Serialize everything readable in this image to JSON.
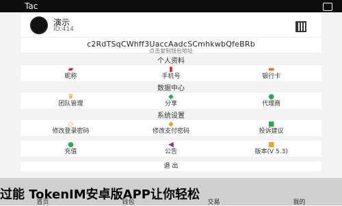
{
  "status": {
    "title": "Tac"
  },
  "profile": {
    "name": "演示",
    "uid": "ID:414"
  },
  "wallet": {
    "address": "c2RdTSqCWhff3UaccAadcSCmhkwbQfeBRb",
    "hint": "点击复制钱包地址"
  },
  "sections": [
    {
      "title": "个人资料",
      "items": [
        {
          "label": "昵称",
          "icon": "user-icon",
          "color": "#d12b2b"
        },
        {
          "label": "手机号",
          "icon": "phone-icon",
          "color": "#d12b2b"
        },
        {
          "label": "银行卡",
          "icon": "card-icon",
          "color": "#e0702a"
        }
      ]
    },
    {
      "title": "数据中心",
      "items": [
        {
          "label": "团队管理",
          "icon": "crown-icon",
          "color": "#e0a52a"
        },
        {
          "label": "分享",
          "icon": "share-icon",
          "color": "#2fa84f"
        },
        {
          "label": "代理商",
          "icon": "agent-icon",
          "color": "#2fa84f"
        }
      ]
    },
    {
      "title": "系统设置",
      "items": [
        {
          "label": "修改登录密码",
          "icon": "lock-icon",
          "color": "#e0a52a"
        },
        {
          "label": "修改支付密码",
          "icon": "key-icon",
          "color": "#e0a52a"
        },
        {
          "label": "投诉建议",
          "icon": "chat-icon",
          "color": "#2fa84f"
        }
      ]
    }
  ],
  "extra_row": [
    {
      "label": "充值",
      "icon": "coin-icon",
      "color": "#2fa84f"
    },
    {
      "label": "公告",
      "icon": "speaker-icon",
      "color": "#8e2bb3"
    },
    {
      "label": "版本(V 5.3)",
      "icon": "info-icon",
      "color": "#e0a52a"
    }
  ],
  "logout": "退 出",
  "banner": "过能 TokenIM安卓版APP让你轻松",
  "tabs": [
    "首页",
    "钱包",
    "交易",
    "我的"
  ]
}
